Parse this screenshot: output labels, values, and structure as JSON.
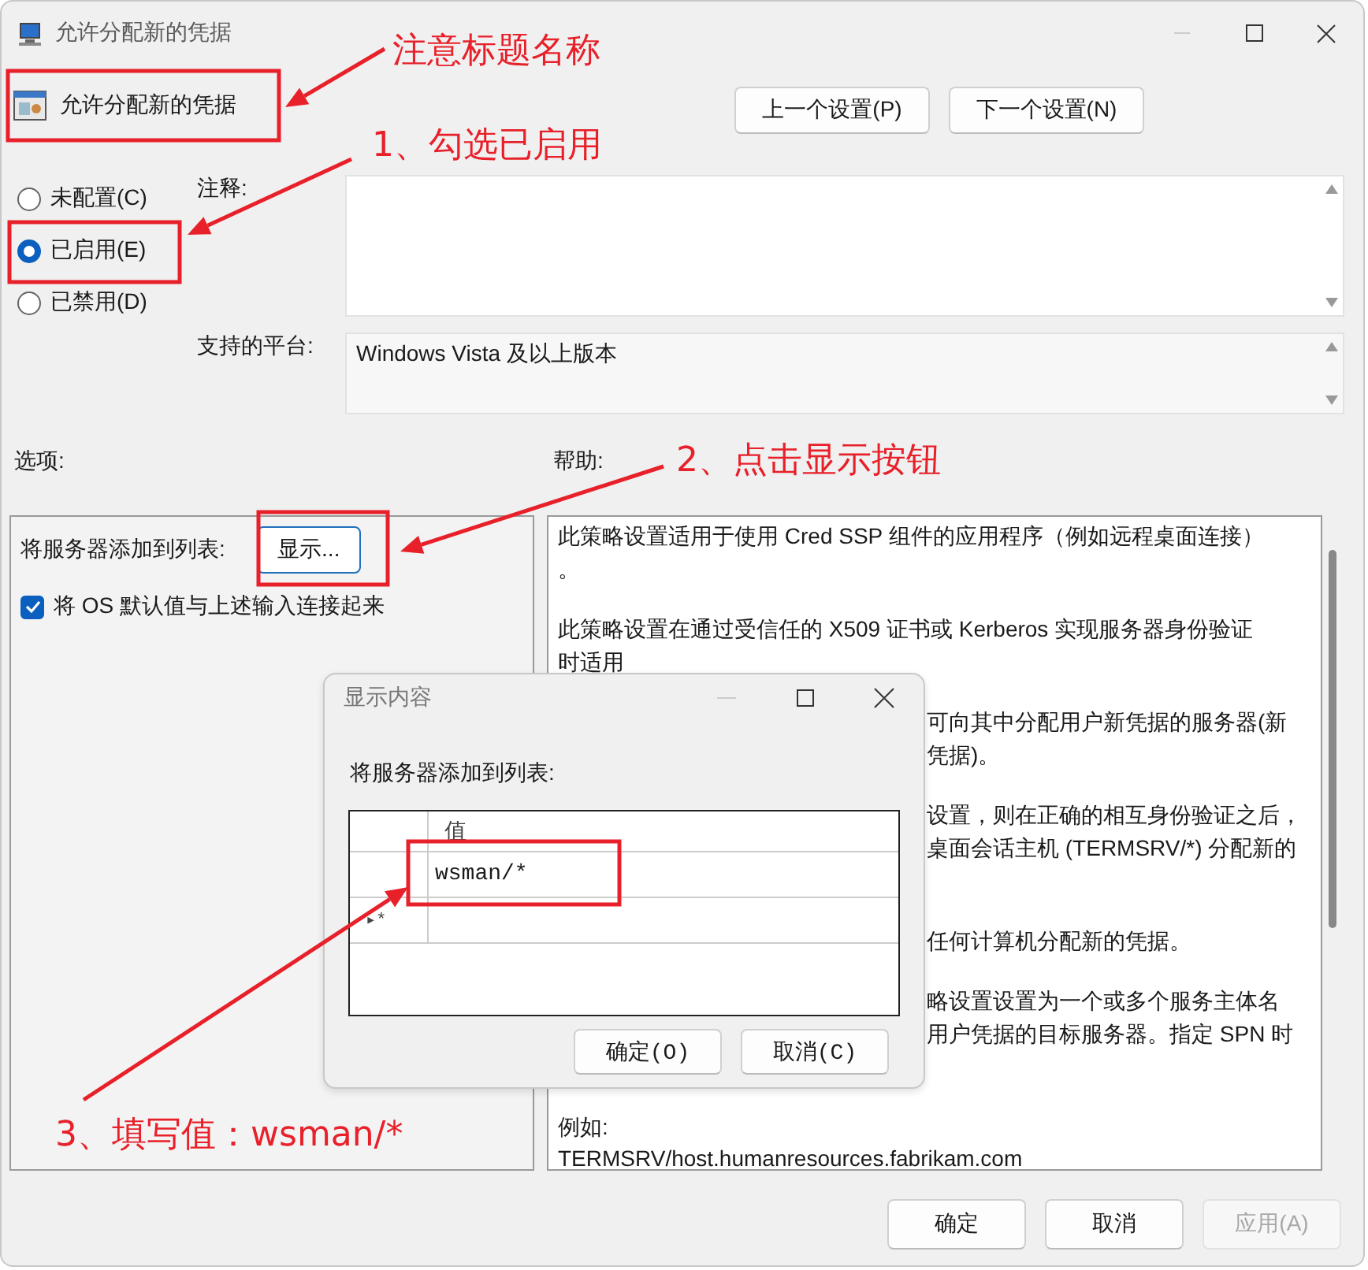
{
  "window": {
    "title": "允许分配新的凭据"
  },
  "header": {
    "title": "允许分配新的凭据",
    "buttons": [
      "上一个设置(P)",
      "下一个设置(N)"
    ]
  },
  "state_options": [
    {
      "label": "未配置(C)",
      "selected": false
    },
    {
      "label": "已启用(E)",
      "selected": true
    },
    {
      "label": "已禁用(D)",
      "selected": false
    }
  ],
  "comment": {
    "label": "注释:"
  },
  "platform": {
    "label": "支持的平台:",
    "value": "Windows Vista 及以上版本"
  },
  "options": {
    "label": "选项:",
    "list_label": "将服务器添加到列表:",
    "show_button": "显示...",
    "concat": {
      "label": "将 OS 默认值与上述输入连接起来",
      "checked": true
    }
  },
  "help": {
    "label": "帮助:",
    "paragraphs": [
      {
        "lines": [
          {
            "text": "此策略设置适用于使用 Cred SSP 组件的应用程序（例如远程桌面连接）",
            "covered": false
          },
          {
            "text": "。",
            "covered": false
          }
        ]
      },
      {
        "lines": [
          {
            "text": "此策略设置在通过受信任的 X509 证书或 Kerberos 实现服务器身份验证",
            "covered": false
          },
          {
            "text": "时适用",
            "covered": false
          }
        ]
      },
      {
        "lines": [
          {
            "text": "可向其中分配用户新凭据的服务器(新",
            "covered": true
          },
          {
            "text": "凭据)。",
            "covered": true
          }
        ]
      },
      {
        "continues": true,
        "lines": [
          {
            "text": "设置，则在正确的相互身份验证之后，",
            "covered": true
          },
          {
            "text": "桌面会话主机 (TERMSRV/*) 分配新的",
            "covered": true
          }
        ]
      },
      {
        "lines": [
          {
            "text": "任何计算机分配新的凭据。",
            "covered": true
          }
        ]
      },
      {
        "continues": true,
        "lines": [
          {
            "text": "略设置设置为一个或多个服务主体名",
            "covered": true
          },
          {
            "text": "用户凭据的目标服务器。指定 SPN 时",
            "covered": true
          }
        ]
      },
      {
        "lines": [
          {
            "text": "例如:",
            "covered": false
          },
          {
            "text": "TERMSRV/host.humanresources.fabrikam.com",
            "covered": false
          }
        ]
      }
    ]
  },
  "buttons": [
    {
      "label": "确定",
      "disabled": false
    },
    {
      "label": "取消",
      "disabled": false
    },
    {
      "label": "应用(A)",
      "disabled": true
    }
  ],
  "dialog": {
    "title": "显示内容",
    "label": "将服务器添加到列表:",
    "columns": [
      "值"
    ],
    "rows": [
      {
        "kind": "value",
        "value": "wsman/*"
      },
      {
        "kind": "new",
        "marker": "▸*"
      }
    ],
    "buttons": [
      "确定(O)",
      "取消(C)"
    ]
  },
  "annotations": [
    {
      "text": "注意标题名称"
    },
    {
      "text": "1、勾选已启用"
    },
    {
      "text": "2、点击显示按钮"
    },
    {
      "text": "3、填写值：wsman/*"
    }
  ]
}
